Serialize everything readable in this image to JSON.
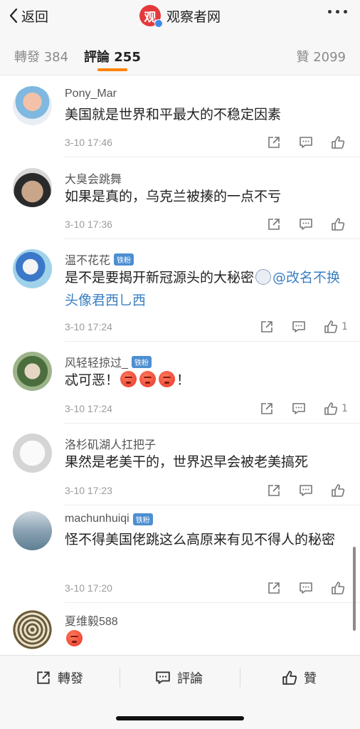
{
  "nav": {
    "back_label": "返回",
    "logo_char": "观",
    "title": "观察者网"
  },
  "tabs": {
    "repost": "轉發 384",
    "comment": "評論 255",
    "like": "贊 2099"
  },
  "comments": [
    {
      "name": "Pony_Mar",
      "badge": "",
      "text": "美国就是世界和平最大的不稳定因素",
      "time": "3-10 17:46",
      "likes": ""
    },
    {
      "name": "大臭会跳舞",
      "badge": "",
      "text": "如果是真的，乌克兰被揍的一点不亏",
      "time": "3-10 17:36",
      "likes": ""
    },
    {
      "name": "温不花花",
      "badge": "铁粉",
      "text": "是不是要揭开新冠源头的大秘密",
      "mention": "@改名不换头像君西乚西",
      "time": "3-10 17:24",
      "likes": "1"
    },
    {
      "name": "风轻轻掠过_",
      "badge": "铁粉",
      "text_prefix": "忒可恶！",
      "text_suffix": "！",
      "time": "3-10 17:24",
      "likes": "1"
    },
    {
      "name": "洛杉矶湖人扛把子",
      "badge": "",
      "text": "果然是老美干的，世界迟早会被老美搞死",
      "time": "3-10 17:23",
      "likes": ""
    },
    {
      "name": "machunhuiqi",
      "badge": "铁粉",
      "text": "怪不得美国佬跳这么高原来有见不得人的秘密",
      "time": "3-10 17:20",
      "likes": ""
    },
    {
      "name": "夏维毅588",
      "badge": "",
      "text": "",
      "time": "",
      "likes": ""
    }
  ],
  "bottom": {
    "repost": "轉發",
    "comment": "評論",
    "like": "贊"
  },
  "icons": [
    "chevron-left-icon",
    "verified-icon",
    "more-icon",
    "share-icon",
    "comment-icon",
    "like-icon",
    "angry-emoji-icon",
    "doge-emoji-icon"
  ],
  "colors": {
    "accent": "#ff8200",
    "mention": "#3a7fc2",
    "badge": "#4d8fd1",
    "brand": "#e4393c"
  }
}
